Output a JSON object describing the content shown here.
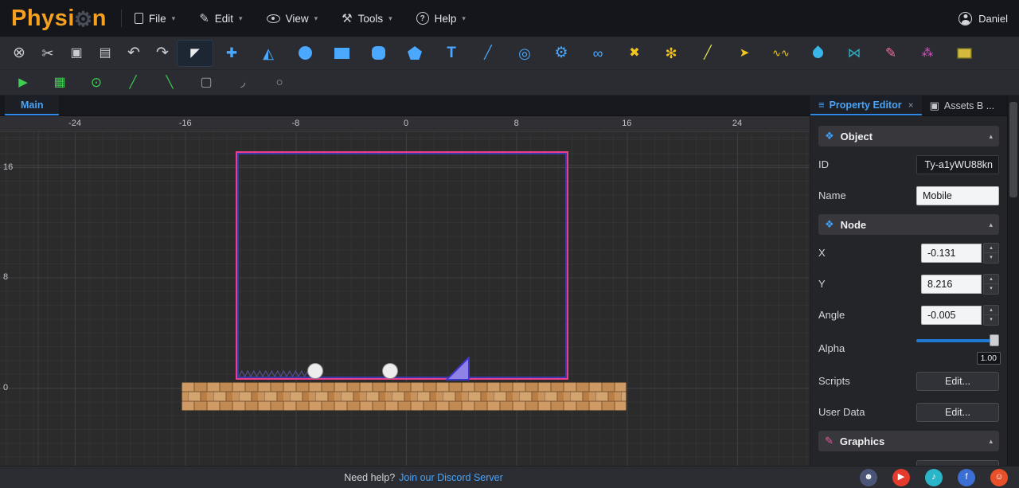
{
  "header": {
    "logo": {
      "prefix": "Physi",
      "gear": "⚙",
      "suffix": "n"
    },
    "menus": [
      {
        "label": "File"
      },
      {
        "label": "Edit",
        "glyph": "✎"
      },
      {
        "label": "View"
      },
      {
        "label": "Tools",
        "glyph": "⚒"
      },
      {
        "label": "Help",
        "glyph": "?"
      }
    ],
    "user": {
      "name": "Daniel"
    }
  },
  "ui": {
    "chevron": "▾",
    "spin_up": "▴",
    "spin_down": "▾",
    "close": "×",
    "collapse": "▴",
    "prop_tab_icon": "≡",
    "assets_tab_icon": "▣",
    "object_icon": "❖",
    "node_icon": "❖",
    "graphics_icon": "✎"
  },
  "toolbar_edit": [
    {
      "name": "deselect",
      "glyph": "⊗",
      "color": "#c8cbd0",
      "size": 19
    },
    {
      "name": "cut",
      "glyph": "✂",
      "color": "#c8cbd0",
      "size": 18
    },
    {
      "name": "copy",
      "glyph": "▣",
      "color": "#c8cbd0",
      "size": 16
    },
    {
      "name": "paste",
      "glyph": "▤",
      "color": "#c8cbd0",
      "size": 16
    },
    {
      "name": "undo",
      "glyph": "↶",
      "color": "#c8cbd0",
      "size": 19
    },
    {
      "name": "redo",
      "glyph": "↷",
      "color": "#c8cbd0",
      "size": 19
    }
  ],
  "toolbar_tools": [
    {
      "name": "select",
      "glyph": "◤",
      "color": "#e9ebef",
      "size": 15,
      "active": true
    },
    {
      "name": "move",
      "glyph": "✚",
      "color": "#4aa8ff",
      "size": 17
    },
    {
      "name": "mirror",
      "glyph": "◭",
      "color": "#4aa8ff",
      "size": 18
    },
    {
      "name": "circle",
      "shape": "circle",
      "color": "#4aa8ff"
    },
    {
      "name": "rectangle",
      "shape": "rect",
      "color": "#4aa8ff"
    },
    {
      "name": "rounded-rect",
      "shape": "roundsq",
      "color": "#4aa8ff"
    },
    {
      "name": "polygon",
      "shape": "pentagon",
      "color": "#4aa8ff"
    },
    {
      "name": "text",
      "glyph": "T",
      "color": "#4aa8ff",
      "size": 19,
      "bold": true
    },
    {
      "name": "polyline",
      "glyph": "╱",
      "color": "#4aa8ff",
      "size": 16
    },
    {
      "name": "spiral",
      "glyph": "◎",
      "color": "#4aa8ff",
      "size": 18
    },
    {
      "name": "gear",
      "glyph": "⚙",
      "color": "#4aa8ff",
      "size": 19
    },
    {
      "name": "joint",
      "glyph": "∞",
      "color": "#4aa8ff",
      "size": 18
    },
    {
      "name": "fixed-joint",
      "glyph": "✖",
      "color": "#f2c41d",
      "size": 16
    },
    {
      "name": "decoration",
      "glyph": "✻",
      "color": "#f2c41d",
      "size": 18
    },
    {
      "name": "line",
      "glyph": "╱",
      "color": "#dde24e",
      "size": 16
    },
    {
      "name": "tracer",
      "glyph": "➤",
      "color": "#f2c41d",
      "size": 15
    },
    {
      "name": "spring",
      "glyph": "∿∿",
      "color": "#f2c41d",
      "size": 13
    },
    {
      "name": "water",
      "shape": "drop",
      "color": "#38b6e8"
    },
    {
      "name": "pulley",
      "glyph": "⋈",
      "color": "#2fa8bc",
      "size": 17
    },
    {
      "name": "brush",
      "glyph": "✎",
      "color": "#f268a2",
      "size": 17
    },
    {
      "name": "particles",
      "glyph": "⁂",
      "color": "#e052c8",
      "size": 15
    },
    {
      "name": "screenshot",
      "shape": "photo",
      "color": "#d4b93c"
    }
  ],
  "toolbar_secondary": [
    {
      "name": "run",
      "glyph": "▶",
      "color": "#3ecf52",
      "size": 15
    },
    {
      "name": "grid-snap",
      "glyph": "▦",
      "color": "#3ecf52",
      "size": 16
    },
    {
      "name": "center-snap",
      "glyph": "⊙",
      "color": "#3ecf52",
      "size": 17
    },
    {
      "name": "segment",
      "glyph": "╱",
      "color": "#3ecf52",
      "size": 15
    },
    {
      "name": "edge-snap",
      "glyph": "╲",
      "color": "#3ecf52",
      "size": 15
    },
    {
      "name": "union",
      "glyph": "▢",
      "color": "#9ba0a8",
      "size": 16
    },
    {
      "name": "arc",
      "glyph": "◞",
      "color": "#9ba0a8",
      "size": 16
    },
    {
      "name": "ellipse",
      "glyph": "○",
      "color": "#9ba0a8",
      "size": 15
    }
  ],
  "canvas": {
    "tab": "Main",
    "ruler_x": [
      {
        "label": "-24",
        "v": -24
      },
      {
        "label": "-16",
        "v": -16
      },
      {
        "label": "-8",
        "v": -8
      },
      {
        "label": "0",
        "v": 0
      },
      {
        "label": "8",
        "v": 8
      },
      {
        "label": "16",
        "v": 16
      },
      {
        "label": "24",
        "v": 24
      }
    ],
    "ruler_y": [
      {
        "label": "16",
        "v": 16
      },
      {
        "label": "8",
        "v": 8
      },
      {
        "label": "0",
        "v": 0
      }
    ]
  },
  "panel": {
    "tabs": [
      {
        "label": "Property Editor"
      },
      {
        "label": "Assets B ..."
      }
    ],
    "object": {
      "title": "Object",
      "id_label": "ID",
      "id_value": "Ty-a1yWU88kn",
      "name_label": "Name",
      "name_value": "Mobile"
    },
    "node": {
      "title": "Node",
      "x_label": "X",
      "x_value": "-0.131",
      "y_label": "Y",
      "y_value": "8.216",
      "angle_label": "Angle",
      "angle_value": "-0.005",
      "alpha_label": "Alpha",
      "alpha_value": "1.00",
      "scripts_label": "Scripts",
      "scripts_button": "Edit...",
      "userdata_label": "User Data",
      "userdata_button": "Edit..."
    },
    "graphics": {
      "title": "Graphics"
    }
  },
  "status": {
    "prefix": "Need help?",
    "link": "Join our Discord Server",
    "social": [
      {
        "name": "discord",
        "color": "#4a5578",
        "glyph": "☻"
      },
      {
        "name": "youtube",
        "color": "#e33b2e",
        "glyph": "▶"
      },
      {
        "name": "tiktok",
        "color": "#2ab5c9",
        "glyph": "♪"
      },
      {
        "name": "facebook",
        "color": "#3b6fd4",
        "glyph": "f"
      },
      {
        "name": "reddit",
        "color": "#e8502a",
        "glyph": "☺"
      }
    ]
  }
}
